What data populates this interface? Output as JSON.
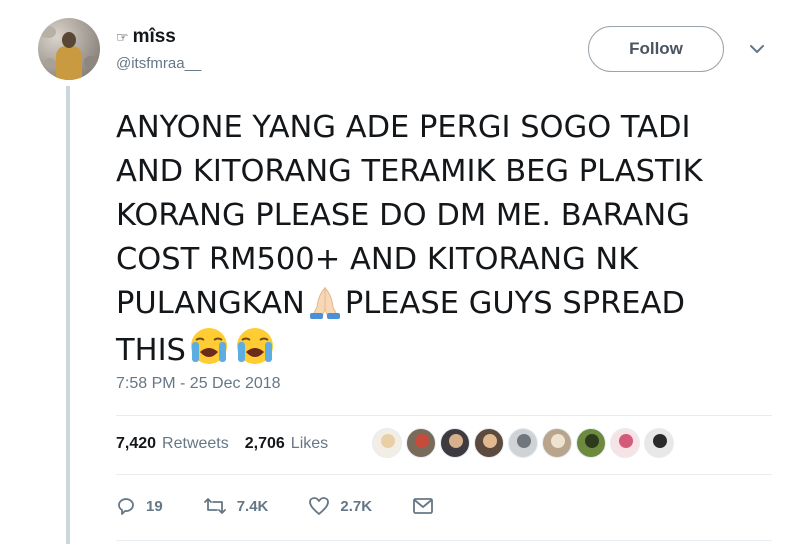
{
  "user": {
    "display_name": "mîss",
    "name_prefix_icon": "☞",
    "handle": "@itsfmraa__"
  },
  "follow_label": "Follow",
  "tweet": {
    "lines": [
      "ANYONE YANG ADE PERGI SOGO TADI",
      "AND KITORANG TERAMIK BEG PLASTIK",
      "KORANG PLEASE DO DM ME. BARANG",
      "COST RM500+ AND KITORANG NK",
      "PULANGKAN",
      "PLEASE GUYS SPREAD",
      "THIS"
    ],
    "emojis": [
      "folded-hands-emoji",
      "loudly-crying-face-emoji",
      "loudly-crying-face-emoji"
    ]
  },
  "timestamp": "7:58 PM - 25 Dec 2018",
  "stats": {
    "retweets_count": "7,420",
    "retweets_label": "Retweets",
    "likes_count": "2,706",
    "likes_label": "Likes"
  },
  "likers": [
    {
      "icon": "liker-avatar",
      "bg": "#f2eee6",
      "fg": "#e8cfa6"
    },
    {
      "icon": "liker-avatar",
      "bg": "#7a6a5a",
      "fg": "#c74b3b"
    },
    {
      "icon": "liker-avatar",
      "bg": "#3d3a40",
      "fg": "#d6b08c"
    },
    {
      "icon": "liker-avatar",
      "bg": "#5b4a3d",
      "fg": "#e0b990"
    },
    {
      "icon": "liker-avatar",
      "bg": "#cfd3d6",
      "fg": "#6f767d"
    },
    {
      "icon": "liker-avatar",
      "bg": "#b9a58d",
      "fg": "#efe2cf"
    },
    {
      "icon": "liker-avatar",
      "bg": "#6e8a3e",
      "fg": "#2d3b1c"
    },
    {
      "icon": "liker-avatar",
      "bg": "#f6e3e6",
      "fg": "#d45a7a"
    },
    {
      "icon": "liker-avatar",
      "bg": "#e8e8e8",
      "fg": "#2b2b2b"
    }
  ],
  "actions": {
    "reply_count": "19",
    "retweet_count": "7.4K",
    "like_count": "2.7K"
  },
  "colors": {
    "text": "#14171a",
    "secondary": "#657786",
    "divider": "#e6ecf0"
  }
}
